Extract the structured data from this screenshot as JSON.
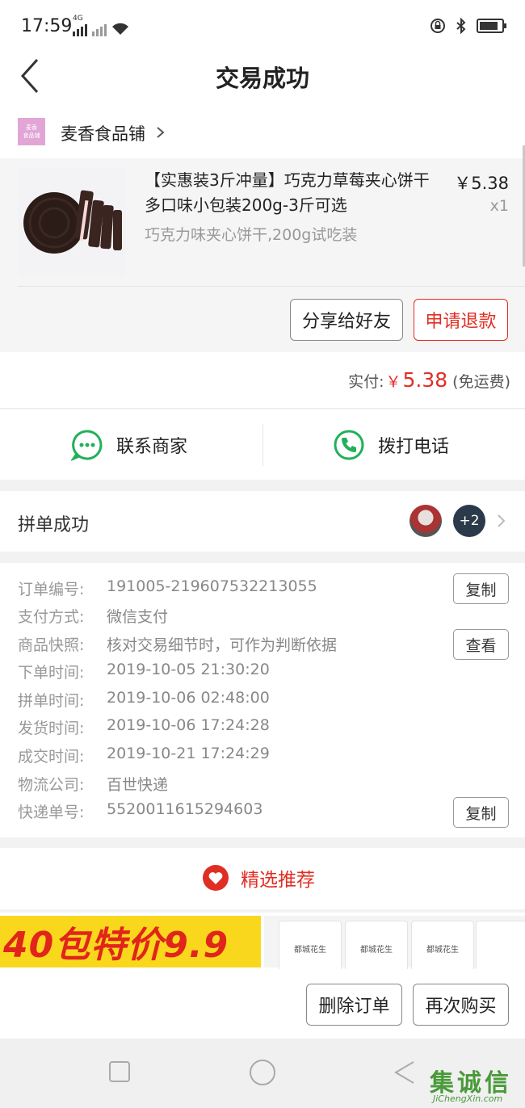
{
  "status_bar": {
    "time": "17:59",
    "network": "4G",
    "wifi_icon": "wifi-icon",
    "lock_icon": "lock-rotation-icon",
    "bluetooth_icon": "bluetooth-icon",
    "battery_icon": "battery-icon"
  },
  "header": {
    "title": "交易成功",
    "back_icon": "back-arrow-icon"
  },
  "shop": {
    "logo_text_1": "麦香",
    "logo_text_2": "食品铺",
    "name": "麦香食品铺",
    "chevron_icon": "chevron-right-icon"
  },
  "product": {
    "title": "【实惠装3斤冲量】巧克力草莓夹心饼干多口味小包装200g-3斤可选",
    "sku": "巧克力味夹心饼干,200g试吃装",
    "price": "￥5.38",
    "quantity": "x1",
    "share_label": "分享给好友",
    "refund_label": "申请退款"
  },
  "payment": {
    "label": "实付:",
    "currency": "￥",
    "amount": "5.38",
    "note": "(免运费)"
  },
  "contact": {
    "merchant_label": "联系商家",
    "phone_label": "拨打电话",
    "accent": "#21b05a"
  },
  "group": {
    "label": "拼单成功",
    "extra_count": "+2"
  },
  "order_info": {
    "rows": [
      {
        "label": "订单编号:",
        "value": "191005-219607532213055",
        "button": "复制"
      },
      {
        "label": "支付方式:",
        "value": "微信支付"
      },
      {
        "label": "商品快照:",
        "value": "核对交易细节时，可作为判断依据",
        "button": "查看"
      },
      {
        "label": "下单时间:",
        "value": "2019-10-05 21:30:20"
      },
      {
        "label": "拼单时间:",
        "value": "2019-10-06 02:48:00"
      },
      {
        "label": "发货时间:",
        "value": "2019-10-06 17:24:28"
      },
      {
        "label": "成交时间:",
        "value": "2019-10-21 17:24:29"
      },
      {
        "label": "物流公司:",
        "value": "百世快递"
      },
      {
        "label": "快递单号:",
        "value": "5520011615294603",
        "button": "复制"
      }
    ]
  },
  "recommend": {
    "label": "精选推荐",
    "icon": "heart-icon",
    "color": "#e02e24"
  },
  "banner": {
    "text": "40包特价9.9",
    "pack_label": "都城花生"
  },
  "actions": {
    "delete_label": "删除订单",
    "rebuy_label": "再次购买"
  },
  "nav": {
    "recent_icon": "square-icon",
    "home_icon": "circle-icon",
    "back_icon": "triangle-back-icon"
  },
  "watermark": {
    "text": "集诚信",
    "url": "JiChengXin.com"
  }
}
